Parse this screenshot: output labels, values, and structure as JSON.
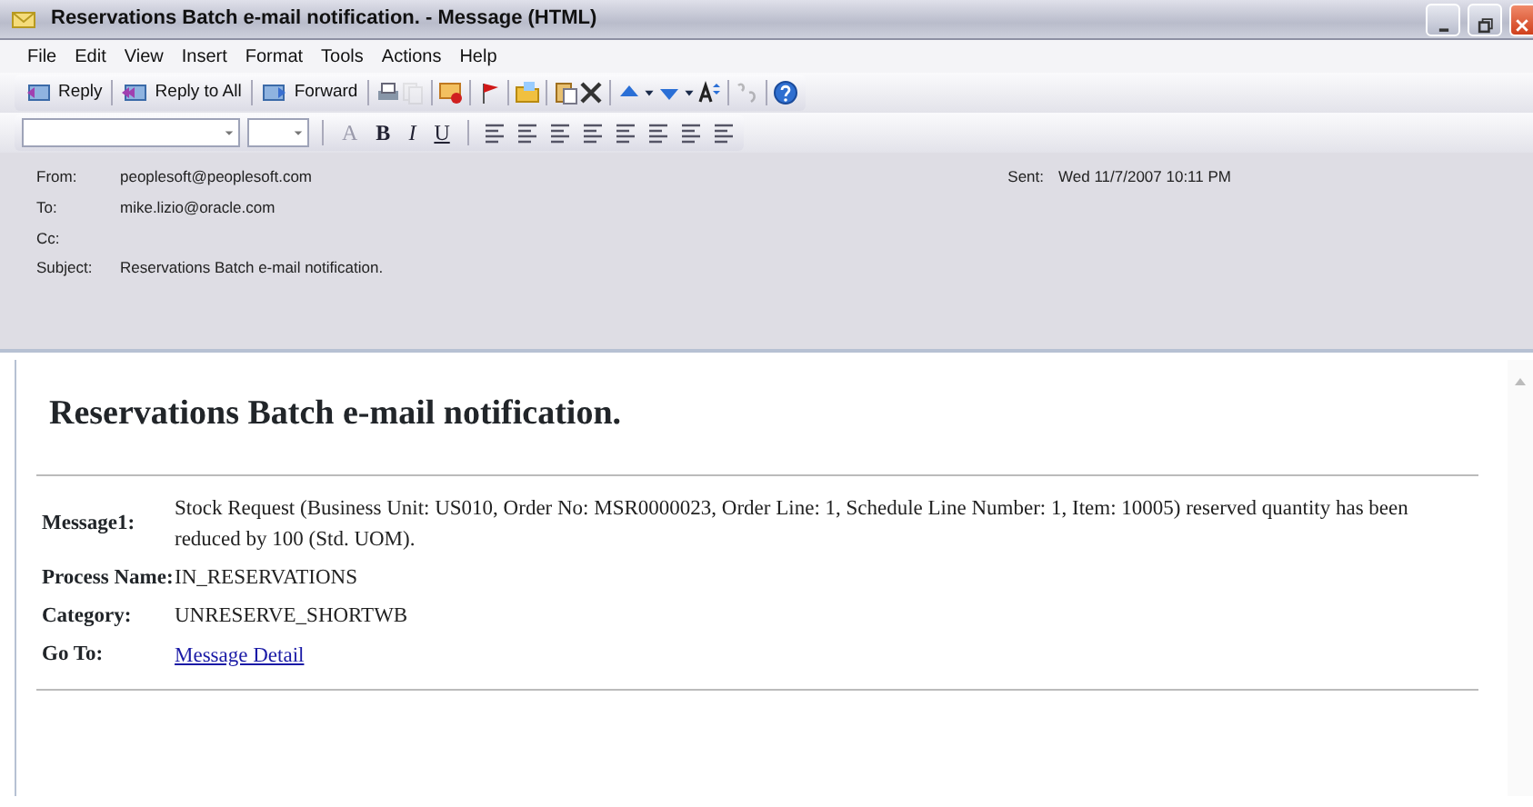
{
  "window": {
    "title": "Reservations Batch e-mail notification. - Message (HTML)"
  },
  "menu": [
    "File",
    "Edit",
    "View",
    "Insert",
    "Format",
    "Tools",
    "Actions",
    "Help"
  ],
  "toolbar": [
    {
      "kind": "button",
      "label": "Reply"
    },
    {
      "kind": "sep"
    },
    {
      "kind": "button",
      "label": "Reply to All"
    },
    {
      "kind": "sep"
    },
    {
      "kind": "button",
      "label": "Forward"
    },
    {
      "kind": "sep"
    },
    {
      "kind": "icon",
      "disabled": false
    },
    {
      "kind": "icon",
      "disabled": true
    },
    {
      "kind": "sep"
    },
    {
      "kind": "icon",
      "disabled": false
    },
    {
      "kind": "sep"
    },
    {
      "kind": "icon",
      "disabled": false
    },
    {
      "kind": "sep"
    },
    {
      "kind": "icon",
      "disabled": false
    },
    {
      "kind": "sep"
    },
    {
      "kind": "icon",
      "disabled": false
    },
    {
      "kind": "icon",
      "disabled": false
    },
    {
      "kind": "sep"
    },
    {
      "kind": "icon",
      "disabled": false
    },
    {
      "kind": "icon",
      "disabled": false
    },
    {
      "kind": "icon",
      "disabled": false
    },
    {
      "kind": "icon",
      "disabled": false
    },
    {
      "kind": "icon",
      "disabled": false
    },
    {
      "kind": "sep"
    },
    {
      "kind": "icon",
      "disabled": true
    },
    {
      "kind": "sep"
    },
    {
      "kind": "icon",
      "disabled": false
    }
  ],
  "format_toolbar": {
    "chars": [
      "A",
      "B",
      "I",
      "U"
    ]
  },
  "header": {
    "fields": [
      {
        "label": "From:",
        "value": "peoplesoft@peoplesoft.com"
      },
      {
        "label": "To:",
        "value": "mike.lizio@oracle.com"
      },
      {
        "label": "Cc:"
      },
      {
        "label": "Subject:",
        "value": "Reservations Batch e-mail notification."
      }
    ],
    "sent": {
      "label": "Sent:",
      "value": "Wed 11/7/2007 10:11 PM"
    }
  },
  "body": {
    "heading": "Reservations Batch e-mail notification.",
    "rows": [
      {
        "label": "Message1:",
        "value": "Stock Request (Business Unit: US010, Order No: MSR0000023, Order Line: 1, Schedule Line Number: 1, Item: 10005) reserved quantity has been reduced by 100 (Std. UOM).",
        "kind": "text"
      },
      {
        "label": "Process Name:",
        "value": "IN_RESERVATIONS",
        "kind": "text"
      },
      {
        "label": "Category:",
        "value": "UNRESERVE_SHORTWB",
        "kind": "text"
      },
      {
        "label": "Go To:",
        "value": "Message Detail",
        "kind": "link"
      }
    ]
  }
}
